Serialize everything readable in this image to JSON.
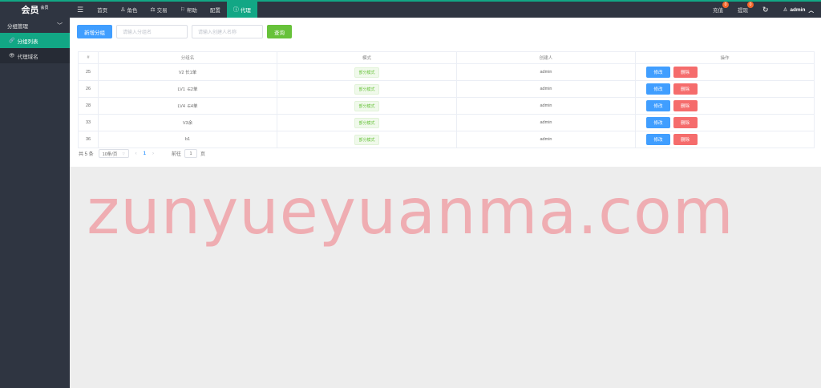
{
  "brand": {
    "title": "会员",
    "sup": "会员"
  },
  "nav": {
    "menu_icon": "☰",
    "items": [
      {
        "label": "首页",
        "icon": ""
      },
      {
        "label": "角色",
        "icon": "user-icon"
      },
      {
        "label": "交易",
        "icon": "scale-icon"
      },
      {
        "label": "帮助",
        "icon": "flag-icon"
      },
      {
        "label": "配置",
        "icon": ""
      },
      {
        "label": "代理",
        "icon": "info-icon"
      }
    ]
  },
  "topright": {
    "recharge": {
      "label": "充值",
      "badge": "0"
    },
    "withdraw": {
      "label": "提现",
      "badge": "0"
    },
    "refresh_icon": "refresh-icon",
    "user": "admin"
  },
  "sidebar": {
    "group": "分组管理",
    "items": [
      {
        "label": "分组列表",
        "icon": "link-icon"
      },
      {
        "label": "代理域名",
        "icon": "eye-icon"
      }
    ]
  },
  "toolbar": {
    "add_label": "新增分组",
    "group_placeholder": "请输入分组名",
    "creator_placeholder": "请输入创建人名称",
    "search_label": "查询"
  },
  "table": {
    "headers": [
      "#",
      "分组名",
      "模式",
      "创建人",
      "操作"
    ],
    "rows": [
      {
        "id": "25",
        "name": "V2 长1单",
        "mode": "部分模式",
        "creator": "admin"
      },
      {
        "id": "26",
        "name": "LV1 ·E2单",
        "mode": "部分模式",
        "creator": "admin"
      },
      {
        "id": "28",
        "name": "LV4 ·E4单",
        "mode": "部分模式",
        "creator": "admin"
      },
      {
        "id": "33",
        "name": "V3余",
        "mode": "部分模式",
        "creator": "admin"
      },
      {
        "id": "36",
        "name": "b1",
        "mode": "部分模式",
        "creator": "admin"
      }
    ],
    "edit_label": "修改",
    "delete_label": "删除"
  },
  "pager": {
    "total": "共 5 条",
    "page_size": "10条/页",
    "current": "1",
    "goto_label": "前往",
    "goto_value": "1",
    "page_unit": "页"
  },
  "watermark": "zunyueyuanma.com"
}
